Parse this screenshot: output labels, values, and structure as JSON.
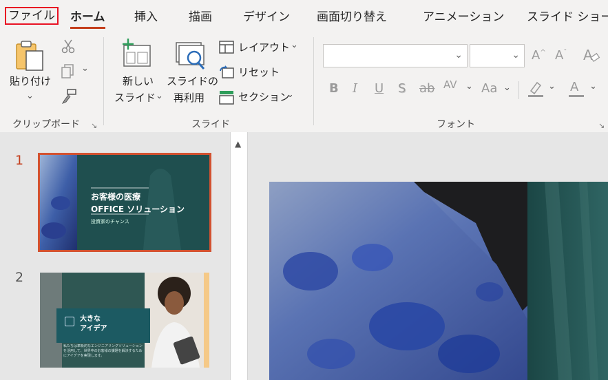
{
  "tabs": [
    {
      "key": "file",
      "label": "ファイル"
    },
    {
      "key": "home",
      "label": "ホーム"
    },
    {
      "key": "insert",
      "label": "挿入"
    },
    {
      "key": "draw",
      "label": "描画"
    },
    {
      "key": "design",
      "label": "デザイン"
    },
    {
      "key": "transitions",
      "label": "画面切り替え"
    },
    {
      "key": "animations",
      "label": "アニメーション"
    },
    {
      "key": "slideshow",
      "label": "スライド ショー"
    }
  ],
  "clipboard": {
    "paste_label": "貼り付け",
    "group_label": "クリップボード"
  },
  "slides_group": {
    "new_slide_line1": "新しい",
    "new_slide_line2": "スライド",
    "reuse_line1": "スライドの",
    "reuse_line2": "再利用",
    "layout": "レイアウト",
    "reset": "リセット",
    "section": "セクション",
    "group_label": "スライド"
  },
  "font_group": {
    "font_name": "",
    "font_size": "",
    "group_label": "フォント",
    "grow": "A",
    "shrink": "A",
    "bold": "B",
    "italic": "I",
    "underline": "U",
    "shadow": "S",
    "strike": "ab",
    "spacing": "AV",
    "case": "Aa",
    "font_color": "A"
  },
  "thumbnails": [
    {
      "number": "1",
      "title_line1": "お客様の医療",
      "title_line2": "OFFICE ソリューション",
      "subtitle": "投資家のチャンス"
    },
    {
      "number": "2",
      "title_line1": "大きな",
      "title_line2": "アイデア",
      "body": "私たちは革新的なエンジニアリングソリューションを活用して、世界中のお客様の課題を解決するためにアイデアを実現します。"
    }
  ],
  "colors": {
    "accent": "#c43e1c",
    "selection_outline": "#d35230",
    "file_box": "#e81123",
    "teal": "#1f4f4f"
  }
}
